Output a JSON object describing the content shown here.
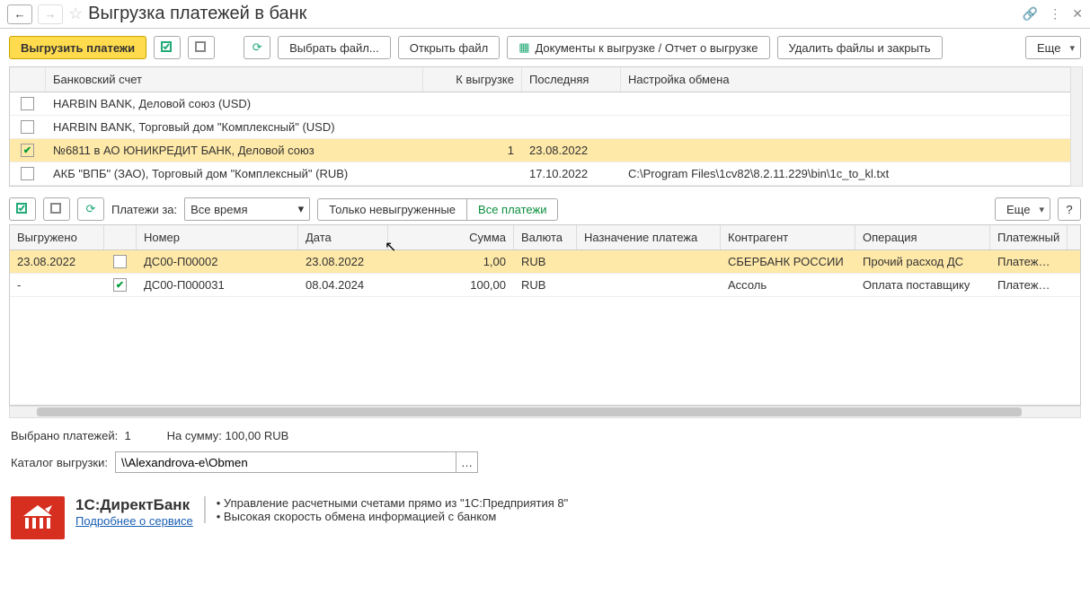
{
  "title": "Выгрузка платежей в банк",
  "toolbar": {
    "export": "Выгрузить платежи",
    "select_file": "Выбрать файл...",
    "open_file": "Открыть файл",
    "docs": "Документы к выгрузке / Отчет о выгрузке",
    "delete_close": "Удалить файлы и закрыть",
    "more": "Еще"
  },
  "accounts": {
    "head": {
      "account": "Банковский счет",
      "qty": "К выгрузке",
      "last": "Последняя",
      "cfg": "Настройка обмена"
    },
    "rows": [
      {
        "checked": false,
        "account": "HARBIN BANK, Деловой союз (USD)",
        "qty": "",
        "last": "",
        "cfg": ""
      },
      {
        "checked": false,
        "account": "HARBIN BANK, Торговый дом \"Комплексный\" (USD)",
        "qty": "",
        "last": "",
        "cfg": ""
      },
      {
        "checked": true,
        "account": "№6811 в АО ЮНИКРЕДИТ БАНК, Деловой союз",
        "qty": "1",
        "last": "23.08.2022",
        "cfg": ""
      },
      {
        "checked": false,
        "account": "АКБ \"ВПБ\" (ЗАО), Торговый дом \"Комплексный\" (RUB)",
        "qty": "",
        "last": "17.10.2022",
        "cfg": "C:\\Program Files\\1cv82\\8.2.11.229\\bin\\1c_to_kl.txt"
      }
    ]
  },
  "sub": {
    "label": "Платежи за:",
    "period": "Все время",
    "only_unloaded": "Только невыгруженные",
    "all_payments": "Все платежи",
    "more": "Еще",
    "help": "?"
  },
  "payments": {
    "head": {
      "exported": "Выгружено",
      "num": "Номер",
      "date": "Дата",
      "sum": "Сумма",
      "cur": "Валюта",
      "purpose": "Назначение платежа",
      "agent": "Контрагент",
      "oper": "Операция",
      "pay": "Платежный"
    },
    "rows": [
      {
        "exported": "23.08.2022",
        "checked": false,
        "num": "ДС00-П00002",
        "date": "23.08.2022",
        "sum": "1,00",
        "cur": "RUB",
        "purpose": "",
        "agent": "СБЕРБАНК РОССИИ",
        "oper": "Прочий расход ДС",
        "pay": "Платежное",
        "selected": true
      },
      {
        "exported": "-",
        "checked": true,
        "num": "ДС00-П000031",
        "date": "08.04.2024",
        "sum": "100,00",
        "cur": "RUB",
        "purpose": "",
        "agent": "Ассоль",
        "oper": "Оплата поставщику",
        "pay": "Платежное",
        "selected": false
      }
    ]
  },
  "summary": {
    "selected_label": "Выбрано платежей:",
    "selected_count": "1",
    "sum_label": "На сумму:",
    "sum_value": "100,00 RUB"
  },
  "catalog": {
    "label": "Каталог выгрузки:",
    "value": "\\\\Alexandrova-e\\Obmen"
  },
  "promo": {
    "title": "1С:ДиректБанк",
    "link": "Подробнее о сервисе",
    "b1": "• Управление расчетными счетами прямо из \"1С:Предприятия 8\"",
    "b2": "• Высокая скорость обмена информацией с банком"
  }
}
